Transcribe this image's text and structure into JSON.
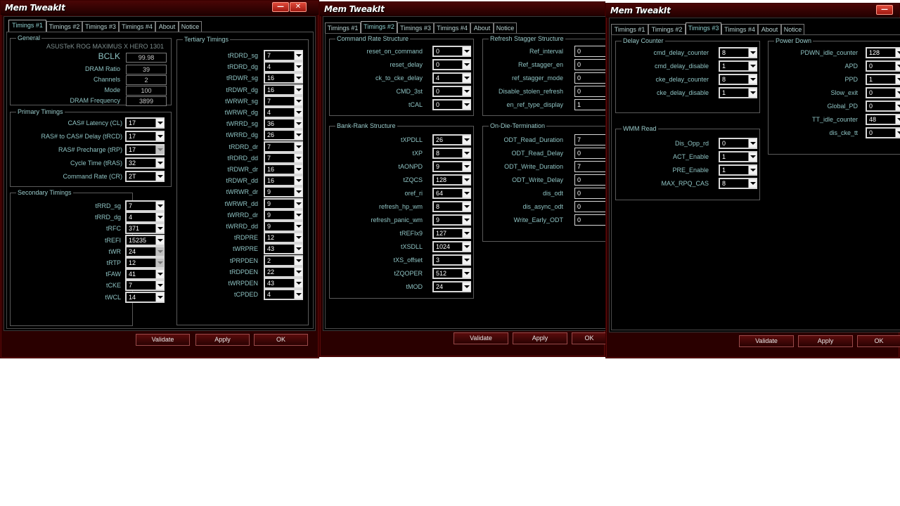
{
  "title": "Mem TweakIt",
  "window_controls": {
    "minimize": "—",
    "close": "✕"
  },
  "tabs": [
    "Timings #1",
    "Timings #2",
    "Timings #3",
    "Timings #4",
    "About",
    "Notice"
  ],
  "buttons": {
    "validate": "Validate",
    "apply": "Apply",
    "ok": "OK"
  },
  "w1": {
    "general": {
      "title": "General",
      "board": "ASUSTeK ROG MAXIMUS X HERO 1301",
      "rows": [
        {
          "label": "BCLK",
          "value": "99.98"
        },
        {
          "label": "DRAM Ratio",
          "value": "39"
        },
        {
          "label": "Channels",
          "value": "2"
        },
        {
          "label": "Mode",
          "value": "100"
        },
        {
          "label": "DRAM Frequency",
          "value": "3899"
        }
      ]
    },
    "primary": {
      "title": "Primary Timings",
      "rows": [
        {
          "label": "CAS# Latency (CL)",
          "value": "17"
        },
        {
          "label": "RAS# to CAS# Delay (tRCD)",
          "value": "17"
        },
        {
          "label": "RAS# Precharge (tRP)",
          "value": "17"
        },
        {
          "label": "Cycle Time (tRAS)",
          "value": "32"
        },
        {
          "label": "Command Rate (CR)",
          "value": "2T"
        }
      ]
    },
    "secondary": {
      "title": "Secondary Timings",
      "rows": [
        {
          "label": "tRRD_sg",
          "value": "7"
        },
        {
          "label": "tRRD_dg",
          "value": "4"
        },
        {
          "label": "tRFC",
          "value": "371"
        },
        {
          "label": "tREFI",
          "value": "15235"
        },
        {
          "label": "tWR",
          "value": "24"
        },
        {
          "label": "tRTP",
          "value": "12"
        },
        {
          "label": "tFAW",
          "value": "41"
        },
        {
          "label": "tCKE",
          "value": "7"
        },
        {
          "label": "tWCL",
          "value": "14"
        }
      ]
    },
    "tertiary": {
      "title": "Tertiary Timings",
      "rows": [
        {
          "label": "tRDRD_sg",
          "value": "7"
        },
        {
          "label": "tRDRD_dg",
          "value": "4"
        },
        {
          "label": "tRDWR_sg",
          "value": "16"
        },
        {
          "label": "tRDWR_dg",
          "value": "16"
        },
        {
          "label": "tWRWR_sg",
          "value": "7"
        },
        {
          "label": "tWRWR_dg",
          "value": "4"
        },
        {
          "label": "tWRRD_sg",
          "value": "36"
        },
        {
          "label": "tWRRD_dg",
          "value": "26"
        },
        {
          "label": "tRDRD_dr",
          "value": "7"
        },
        {
          "label": "tRDRD_dd",
          "value": "7"
        },
        {
          "label": "tRDWR_dr",
          "value": "16"
        },
        {
          "label": "tRDWR_dd",
          "value": "16"
        },
        {
          "label": "tWRWR_dr",
          "value": "9"
        },
        {
          "label": "tWRWR_dd",
          "value": "9"
        },
        {
          "label": "tWRRD_dr",
          "value": "9"
        },
        {
          "label": "tWRRD_dd",
          "value": "9"
        },
        {
          "label": "tRDPRE",
          "value": "12"
        },
        {
          "label": "tWRPRE",
          "value": "43"
        },
        {
          "label": "tPRPDEN",
          "value": "2"
        },
        {
          "label": "tRDPDEN",
          "value": "22"
        },
        {
          "label": "tWRPDEN",
          "value": "43"
        },
        {
          "label": "tCPDED",
          "value": "4"
        }
      ]
    }
  },
  "w2": {
    "command_rate": {
      "title": "Command Rate Structure",
      "rows": [
        {
          "label": "reset_on_command",
          "value": "0"
        },
        {
          "label": "reset_delay",
          "value": "0"
        },
        {
          "label": "ck_to_cke_delay",
          "value": "4"
        },
        {
          "label": "CMD_3st",
          "value": "0"
        },
        {
          "label": "tCAL",
          "value": "0"
        }
      ]
    },
    "refresh_stagger": {
      "title": "Refresh Stagger Structure",
      "rows": [
        {
          "label": "Ref_interval",
          "value": "0"
        },
        {
          "label": "Ref_stagger_en",
          "value": "0"
        },
        {
          "label": "ref_stagger_mode",
          "value": "0"
        },
        {
          "label": "Disable_stolen_refresh",
          "value": "0"
        },
        {
          "label": "en_ref_type_display",
          "value": "1"
        }
      ]
    },
    "bank_rank": {
      "title": "Bank-Rank Structure",
      "rows": [
        {
          "label": "tXPDLL",
          "value": "26"
        },
        {
          "label": "tXP",
          "value": "8"
        },
        {
          "label": "tAONPD",
          "value": "9"
        },
        {
          "label": "tZQCS",
          "value": "128"
        },
        {
          "label": "oref_ri",
          "value": "64"
        },
        {
          "label": "refresh_hp_wm",
          "value": "8"
        },
        {
          "label": "refresh_panic_wm",
          "value": "9"
        },
        {
          "label": "tREFIx9",
          "value": "127"
        },
        {
          "label": "tXSDLL",
          "value": "1024"
        },
        {
          "label": "tXS_offset",
          "value": "3"
        },
        {
          "label": "tZQOPER",
          "value": "512"
        },
        {
          "label": "tMOD",
          "value": "24"
        }
      ]
    },
    "odt": {
      "title": "On-Die-Termination",
      "rows": [
        {
          "label": "ODT_Read_Duration",
          "value": "7"
        },
        {
          "label": "ODT_Read_Delay",
          "value": "0"
        },
        {
          "label": "ODT_Write_Duration",
          "value": "7"
        },
        {
          "label": "ODT_Write_Delay",
          "value": "0"
        },
        {
          "label": "dis_odt",
          "value": "0"
        },
        {
          "label": "dis_async_odt",
          "value": "0"
        },
        {
          "label": "Write_Early_ODT",
          "value": "0"
        }
      ]
    }
  },
  "w3": {
    "delay_counter": {
      "title": "Delay Counter",
      "rows": [
        {
          "label": "cmd_delay_counter",
          "value": "8"
        },
        {
          "label": "cmd_delay_disable",
          "value": "1"
        },
        {
          "label": "cke_delay_counter",
          "value": "8"
        },
        {
          "label": "cke_delay_disable",
          "value": "1"
        }
      ]
    },
    "wmm_read": {
      "title": "WMM Read",
      "rows": [
        {
          "label": "Dis_Opp_rd",
          "value": "0"
        },
        {
          "label": "ACT_Enable",
          "value": "1"
        },
        {
          "label": "PRE_Enable",
          "value": "1"
        },
        {
          "label": "MAX_RPQ_CAS",
          "value": "8"
        }
      ]
    },
    "power_down": {
      "title": "Power Down",
      "rows": [
        {
          "label": "PDWN_idle_counter",
          "value": "128"
        },
        {
          "label": "APD",
          "value": "0"
        },
        {
          "label": "PPD",
          "value": "1"
        },
        {
          "label": "Slow_exit",
          "value": "0"
        },
        {
          "label": "Global_PD",
          "value": "0"
        },
        {
          "label": "TT_idle_counter",
          "value": "48"
        },
        {
          "label": "dis_cke_tt",
          "value": "0"
        }
      ]
    }
  }
}
